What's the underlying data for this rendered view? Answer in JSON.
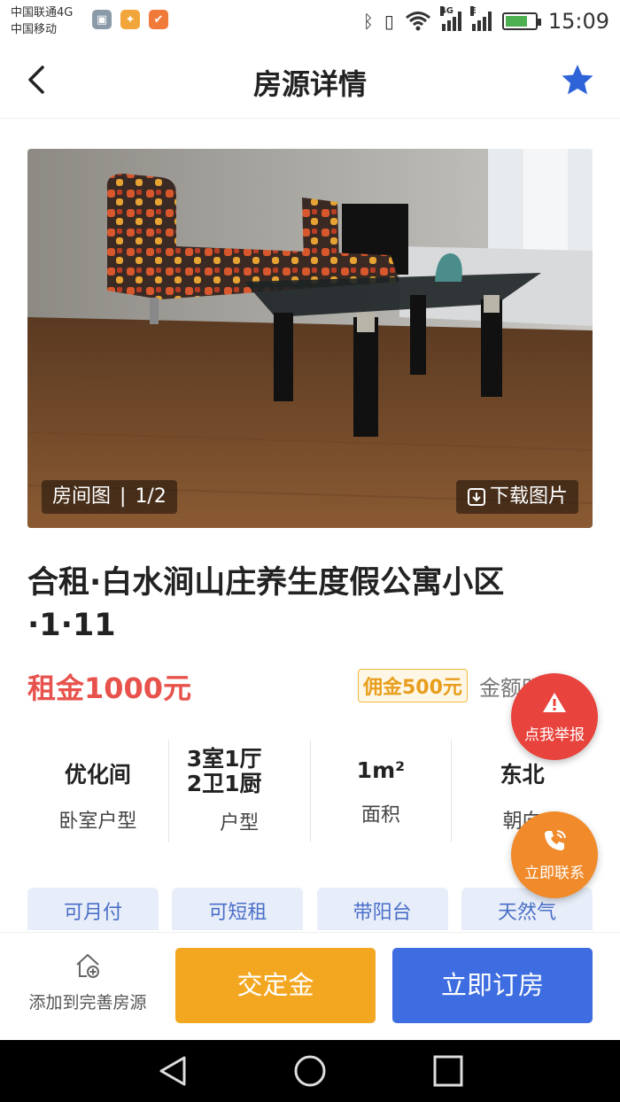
{
  "status_bar": {
    "carrier_line1": "中国联通4G",
    "carrier_line2": "中国移动",
    "network_tag1": "4G",
    "network_tag2": "E",
    "time": "15:09"
  },
  "header": {
    "title": "房源详情"
  },
  "photo": {
    "label": "房间图",
    "separator": "|",
    "counter": "1/2",
    "download_label": "下载图片"
  },
  "listing": {
    "title": "合租·白水涧山庄养生度假公寓小区·1·11",
    "rent": "租金1000元",
    "commission": "佣金500元",
    "amount_note": "金额明细 >"
  },
  "info": [
    {
      "value": "优化间",
      "label": "卧室户型"
    },
    {
      "value": "3室1厅2卫1厨",
      "label": "户型"
    },
    {
      "value": "1m²",
      "label": "面积"
    },
    {
      "value": "东北",
      "label": "朝向"
    }
  ],
  "tags": [
    "可月付",
    "可短租",
    "带阳台",
    "天然气"
  ],
  "floating": {
    "report_label": "点我举报",
    "call_label": "立即联系"
  },
  "action_bar": {
    "add_label": "添加到完善房源",
    "deposit_label": "交定金",
    "book_label": "立即订房"
  },
  "colors": {
    "accent_blue": "#3d6de0",
    "rent_red": "#e8524c",
    "deposit_orange": "#f3a721",
    "report_red": "#e8433d",
    "call_orange": "#f08a2a"
  }
}
